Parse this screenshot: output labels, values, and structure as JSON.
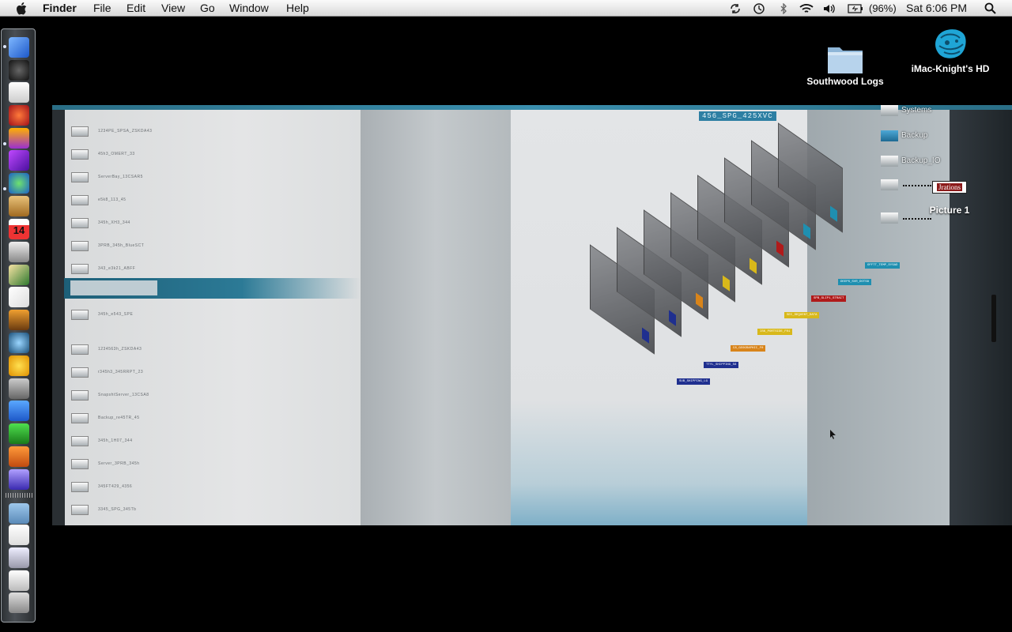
{
  "menubar": {
    "apple_icon": "apple-icon",
    "app_name": "Finder",
    "menus": [
      "File",
      "Edit",
      "View",
      "Go",
      "Window",
      "Help"
    ],
    "battery_percent": "(96%)",
    "clock": "Sat 6:06 PM",
    "status_icons": [
      "sync-icon",
      "time-machine-icon",
      "bluetooth-icon",
      "wifi-icon",
      "volume-icon",
      "battery-icon",
      "spotlight-icon"
    ]
  },
  "desktop": {
    "icons": [
      {
        "label": "Southwood Logs",
        "icon": "folder-icon"
      },
      {
        "label": "iMac-Knight's HD",
        "icon": "hard-drive-icon"
      },
      {
        "label": "Picture 1",
        "icon": "screenshot-icon",
        "thumbnail_text": "Jrations"
      }
    ]
  },
  "wallpaper": {
    "tag": "456_SPG_425XVC",
    "left_rows": [
      "1234PE_SPSA_ZSKDA43",
      "45h3_OMERT_33",
      "ServerBay_13CSAR5",
      "e5k8_113_45",
      "345h_XH3_344",
      "3PRB_345h_BlueSCT",
      "343_e3k21_ABFF",
      "3345_SPG_345Tb",
      "345h_e543_SPE",
      "1234563h_ZSKDA43",
      "r345h3_345RRPT_23",
      "SnapshtServer_13CSA8",
      "Backup_re45TR_45",
      "345h_1H07_344",
      "Server_3PRB_345h",
      "345FT429_4356",
      "3345_SPG_345Tb"
    ],
    "right_labels": [
      "Systems",
      "Backup",
      "Backup_IO"
    ],
    "card_labels": [
      {
        "text": "SUB_SHIPPING_LG",
        "color": "#1f2f8f"
      },
      {
        "text": "TTYL_SHIPPING_56",
        "color": "#1f2f8f"
      },
      {
        "text": "C8_GEOGRAPHIC_F0",
        "color": "#d8841a"
      },
      {
        "text": "ISK_PORTSIDE_F01",
        "color": "#d8b81a"
      },
      {
        "text": "SEC_SEQUENT_DATA",
        "color": "#d8b81a"
      },
      {
        "text": "SPB_SLIP1_STRAIT",
        "color": "#b01a1a"
      },
      {
        "text": "DEEPS_SVR_DOTS8",
        "color": "#1f8fb0"
      },
      {
        "text": "OFFTT_TEMP_SYSAD",
        "color": "#1f8fb0"
      }
    ]
  },
  "dock": {
    "items": [
      "finder-icon",
      "dashboard-icon",
      "preview-icon",
      "game-icon",
      "logo-icon",
      "itunes-icon",
      "messenger-icon",
      "address-book-icon",
      "calendar-icon",
      "dvd-player-icon",
      "solitaire-icon",
      "cards-icon",
      "iphoto-icon",
      "time-machine-icon",
      "yahoo-messenger-icon",
      "system-preferences-icon",
      "word-icon",
      "excel-icon",
      "powerpoint-icon",
      "entourage-icon",
      "folder-icon",
      "document-icon",
      "image-file-icon",
      "mail-file-icon",
      "trash-icon"
    ],
    "calendar_day": "14"
  }
}
